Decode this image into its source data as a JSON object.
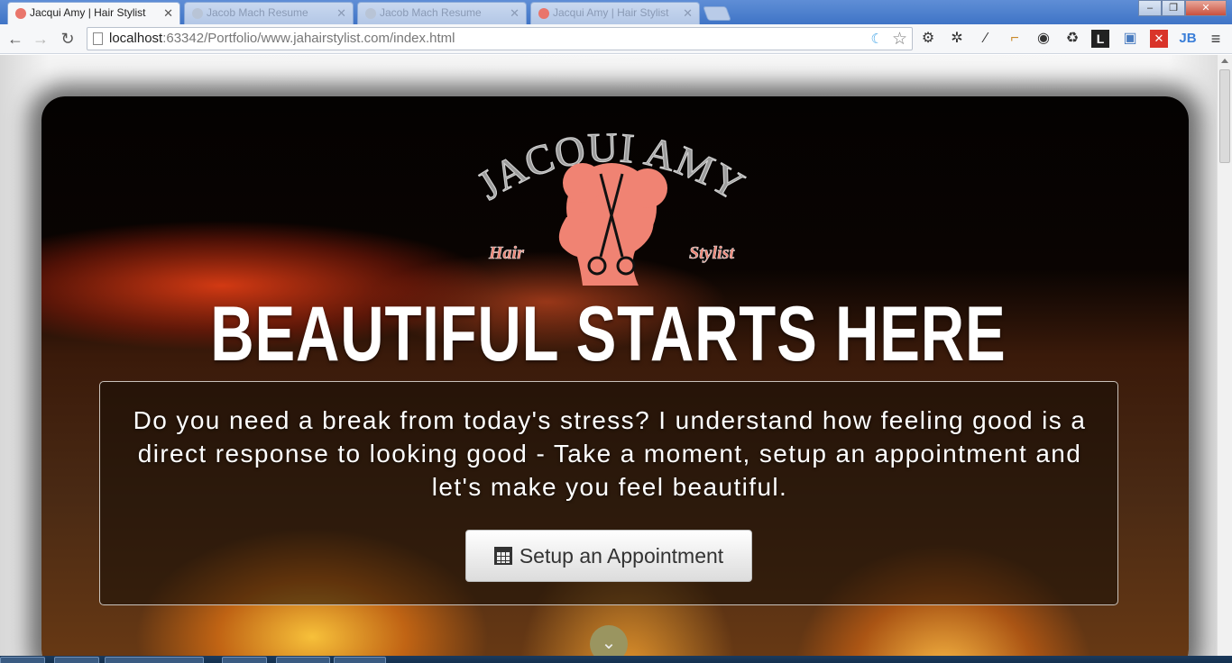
{
  "browser": {
    "tabs": [
      {
        "title": "Jacqui Amy | Hair Stylist",
        "active": true
      },
      {
        "title": "Jacob Mach Resume",
        "active": false
      },
      {
        "title": "Jacob Mach Resume",
        "active": false
      },
      {
        "title": "Jacqui Amy | Hair Stylist",
        "active": false
      }
    ],
    "url_host": "localhost",
    "url_rest": ":63342/Portfolio/www.jahairstylist.com/index.html",
    "window_controls": [
      "–",
      "❐",
      "✕"
    ],
    "extension_icons": [
      "gear-icon",
      "bug-icon",
      "eyedropper-icon",
      "ruler-icon",
      "chrome-settings-icon",
      "recycle-icon",
      "l-icon",
      "window-icon",
      "red-x-icon",
      "jb-icon"
    ]
  },
  "logo": {
    "brand_name": "JACQUI AMY",
    "left_word": "Hair",
    "right_word": "Stylist",
    "accent_color": "#f08373"
  },
  "hero": {
    "headline": "BEAUTIFUL STARTS HERE",
    "intro": "Do you need a break from today's stress? I understand how feeling good is a direct response to looking good - Take a moment, setup an appointment and let's make you feel beautiful.",
    "cta_label": "Setup an Appointment",
    "scroll_icon": "chevron-down-icon"
  }
}
